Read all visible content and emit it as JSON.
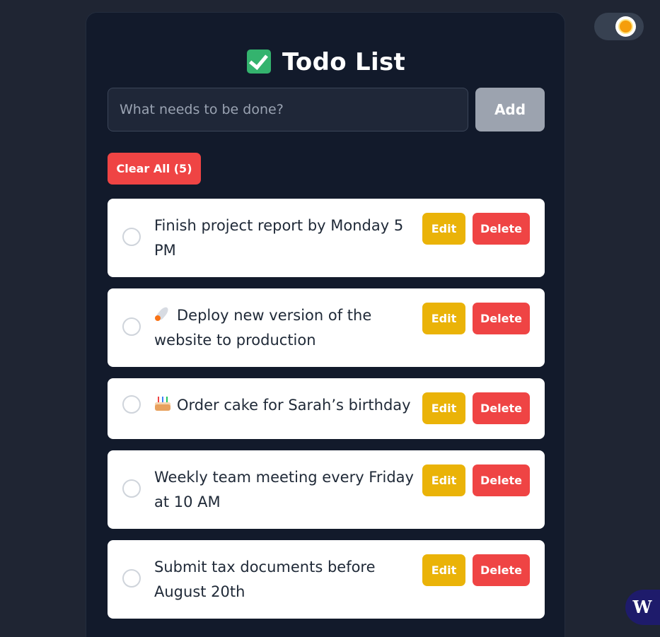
{
  "app": {
    "title": "Todo List",
    "title_icon": "check-box-icon"
  },
  "input": {
    "placeholder": "What needs to be done?",
    "value": ""
  },
  "buttons": {
    "add": "Add",
    "clear_all": "Clear All (5)",
    "edit": "Edit",
    "delete": "Delete"
  },
  "todos": [
    {
      "text": "Finish project report by Monday 5 PM",
      "icon": "",
      "completed": false
    },
    {
      "text": "Deploy new version of the website to production",
      "icon": "rocket-icon",
      "completed": false
    },
    {
      "text": "Order cake for Sarah’s birthday",
      "icon": "cake-icon",
      "completed": false
    },
    {
      "text": "Weekly team meeting every Friday at 10 AM",
      "icon": "",
      "completed": false
    },
    {
      "text": "Submit tax documents before August 20th",
      "icon": "",
      "completed": false
    }
  ],
  "theme_toggle": {
    "icon": "sun-icon",
    "mode": "light"
  },
  "floating_badge": {
    "label": "W"
  },
  "colors": {
    "background": "#1f2533",
    "card": "#121a2b",
    "add_button": "#9ca3af",
    "clear_button": "#ef4444",
    "edit_button": "#eab308",
    "delete_button": "#ef4444"
  }
}
